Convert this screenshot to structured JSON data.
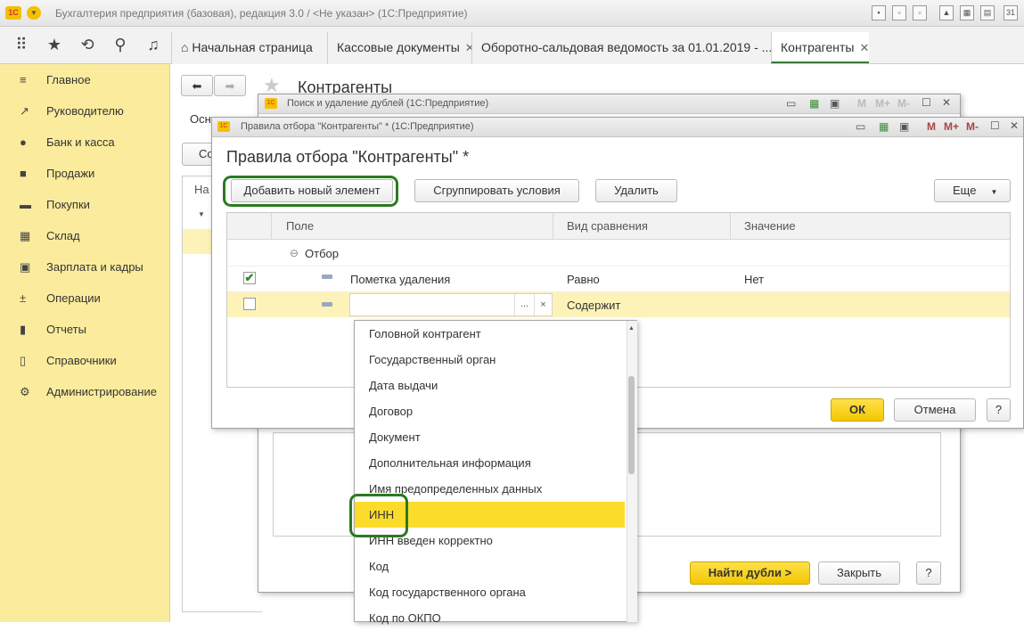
{
  "app": {
    "title": "Бухгалтерия предприятия (базовая), редакция 3.0 / <Не указан>  (1С:Предприятие)",
    "logo": "1С"
  },
  "tabs": [
    {
      "label": "Начальная страница",
      "icon": "home-icon"
    },
    {
      "label": "Кассовые документы"
    },
    {
      "label": "Оборотно-сальдовая ведомость за 01.01.2019 - ..."
    },
    {
      "label": "Контрагенты"
    }
  ],
  "sidebar": {
    "items": [
      {
        "label": "Главное",
        "icon": "menu-icon"
      },
      {
        "label": "Руководителю",
        "icon": "trend-icon"
      },
      {
        "label": "Банк и касса",
        "icon": "coin-icon"
      },
      {
        "label": "Продажи",
        "icon": "bag-icon"
      },
      {
        "label": "Покупки",
        "icon": "cart-icon"
      },
      {
        "label": "Склад",
        "icon": "warehouse-icon"
      },
      {
        "label": "Зарплата и кадры",
        "icon": "people-icon"
      },
      {
        "label": "Операции",
        "icon": "operations-icon"
      },
      {
        "label": "Отчеты",
        "icon": "report-icon"
      },
      {
        "label": "Справочники",
        "icon": "book-icon"
      },
      {
        "label": "Администрирование",
        "icon": "gear-icon"
      }
    ]
  },
  "background": {
    "page_title": "Контрагенты",
    "osn": "Осн",
    "co": "Со",
    "na": "На"
  },
  "dup_window": {
    "title": "Поиск и удаление дублей  (1С:Предприятие)",
    "find_button": "Найти дубли >",
    "close_button": "Закрыть",
    "help": "?"
  },
  "rules_window": {
    "title": "Правила отбора \"Контрагенты\" *  (1С:Предприятие)",
    "heading": "Правила отбора \"Контрагенты\" *",
    "add_button": "Добавить новый элемент",
    "group_button": "Сгруппировать условия",
    "delete_button": "Удалить",
    "more_button": "Еще",
    "ok_button": "ОК",
    "cancel_button": "Отмена",
    "help": "?",
    "columns": {
      "field": "Поле",
      "comparison": "Вид сравнения",
      "value": "Значение"
    },
    "group_row": "Отбор",
    "rows": [
      {
        "checked": true,
        "field": "Пометка удаления",
        "comparison": "Равно",
        "value": "Нет"
      },
      {
        "checked": false,
        "field": "",
        "comparison": "Содержит",
        "value": ""
      }
    ],
    "field_buttons": {
      "select": "...",
      "clear": "×"
    }
  },
  "dropdown": {
    "selected": "ИНН",
    "items": [
      "Головной контрагент",
      "Государственный орган",
      "Дата выдачи",
      "Договор",
      "Документ",
      "Дополнительная информация",
      "Имя предопределенных данных",
      "ИНН",
      "ИНН введен корректно",
      "Код",
      "Код государственного органа",
      "Код по ОКПО"
    ]
  },
  "colors": {
    "sidebar": "#fbec9d",
    "selected_row": "#fdf3b8",
    "accent_yellow": "#f5c800",
    "highlight": "#2a7a20"
  }
}
